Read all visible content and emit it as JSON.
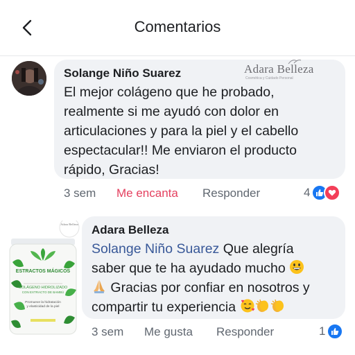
{
  "header": {
    "title": "Comentarios"
  },
  "comments": [
    {
      "author": "Solange Niño Suarez",
      "lines": [
        "El mejor colágeno que he probado,",
        "realmente si me ayudó con dolor en",
        "articulaciones y para la piel y el cabello",
        "espectacular!! Me enviaron el producto",
        "rápido, Gracias!"
      ],
      "time": "3 sem",
      "reaction_action": "Me encanta",
      "reply": "Responder",
      "reaction_count": "4",
      "reaction_icons": [
        "like-icon",
        "love-icon"
      ]
    },
    {
      "author": "Adara Belleza",
      "mention": "Solange Niño Suarez",
      "line1_rest": " Que alegría",
      "line2": "saber que te ha ayudado mucho ",
      "line3": " Gracias por confiar en nosotros y",
      "line4": "compartir tu experiencia ",
      "time": "3 sem",
      "reaction_action": "Me gusta",
      "reply": "Responder",
      "reaction_count": "1",
      "reaction_icons": [
        "like-icon"
      ]
    }
  ],
  "watermark": {
    "name": "Adara Belleza",
    "tagline": "Cosmética y Cuidado Personal"
  },
  "product": {
    "brand": "ESTRACTOS MÁGICOS",
    "line1": "COLÁGENO HIDROLIZADO",
    "line2": "CON EXTRACTO DE BAMBÚ",
    "line3": "Promueve la hidratación",
    "line4": "y elasticidad de la piel",
    "logo_text": "Adara Belleza"
  },
  "colors": {
    "accent_blue": "#385898",
    "love": "#e4405f",
    "bubble": "#f0f2f5"
  }
}
